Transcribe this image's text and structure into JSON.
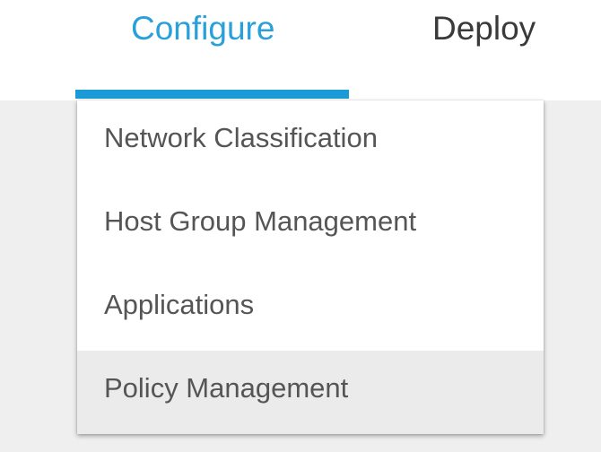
{
  "nav": {
    "tabs": [
      {
        "label": "Configure",
        "active": true
      },
      {
        "label": "Deploy",
        "active": false
      }
    ],
    "accent_color": "#1a9ad6"
  },
  "dropdown": {
    "items": [
      {
        "label": "Network Classification",
        "highlighted": false
      },
      {
        "label": "Host Group Management",
        "highlighted": false
      },
      {
        "label": "Applications",
        "highlighted": false
      },
      {
        "label": "Policy Management",
        "highlighted": true
      }
    ],
    "highlight_color": "#ebebeb"
  }
}
